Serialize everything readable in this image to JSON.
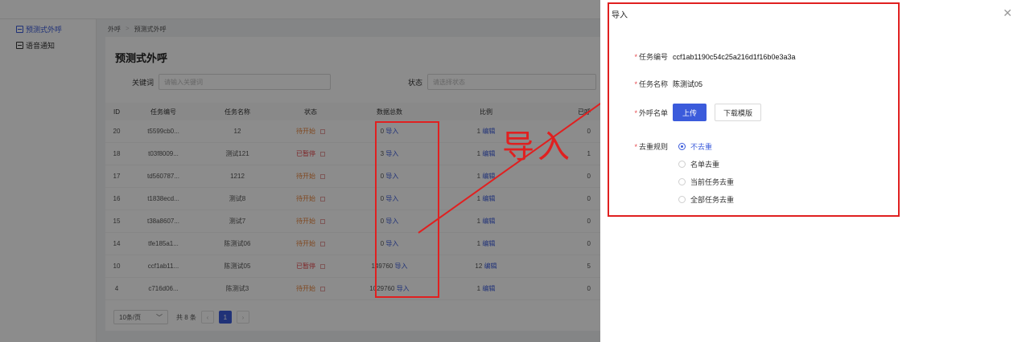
{
  "sidebar": {
    "items": [
      {
        "label": "预测式外呼",
        "active": true
      },
      {
        "label": "语音通知",
        "active": false
      }
    ]
  },
  "breadcrumb": {
    "root": "外呼",
    "current": "预测式外呼"
  },
  "page": {
    "title": "预测式外呼",
    "filters": {
      "keyword_label": "关键词",
      "keyword_placeholder": "请输入关键词",
      "status_label": "状态",
      "status_placeholder": "请选择状态"
    }
  },
  "table": {
    "headers": {
      "id": "ID",
      "no": "任务编号",
      "name": "任务名称",
      "status": "状态",
      "total": "数据总数",
      "ratio": "比例",
      "done": "已呼"
    },
    "rows": [
      {
        "id": "20",
        "no": "t5599cb0...",
        "name": "12",
        "status": "待开始",
        "status_type": "wait",
        "total": "0",
        "import": "导入",
        "ratio": "1",
        "edit": "编辑",
        "done": "0"
      },
      {
        "id": "18",
        "no": "t03f8009...",
        "name": "测试121",
        "status": "已暂停",
        "status_type": "pause",
        "total": "3",
        "import": "导入",
        "ratio": "1",
        "edit": "编辑",
        "done": "1"
      },
      {
        "id": "17",
        "no": "td560787...",
        "name": "1212",
        "status": "待开始",
        "status_type": "wait",
        "total": "0",
        "import": "导入",
        "ratio": "1",
        "edit": "编辑",
        "done": "0"
      },
      {
        "id": "16",
        "no": "t1838ecd...",
        "name": "测试8",
        "status": "待开始",
        "status_type": "wait",
        "total": "0",
        "import": "导入",
        "ratio": "1",
        "edit": "编辑",
        "done": "0"
      },
      {
        "id": "15",
        "no": "t38a8607...",
        "name": "测试7",
        "status": "待开始",
        "status_type": "wait",
        "total": "0",
        "import": "导入",
        "ratio": "1",
        "edit": "编辑",
        "done": "0"
      },
      {
        "id": "14",
        "no": "tfe185a1...",
        "name": "陈测试06",
        "status": "待开始",
        "status_type": "wait",
        "total": "0",
        "import": "导入",
        "ratio": "1",
        "edit": "编辑",
        "done": "0"
      },
      {
        "id": "10",
        "no": "ccf1ab11...",
        "name": "陈测试05",
        "status": "已暂停",
        "status_type": "pause",
        "total": "149760",
        "import": "导入",
        "ratio": "12",
        "edit": "编辑",
        "done": "5"
      },
      {
        "id": "4",
        "no": "c716d06...",
        "name": "陈测试3",
        "status": "待开始",
        "status_type": "wait",
        "total": "1029760",
        "import": "导入",
        "ratio": "1",
        "edit": "编辑",
        "done": "0"
      }
    ]
  },
  "pager": {
    "page_size": "10条/页",
    "total": "共 8 条",
    "current_page": "1"
  },
  "annotation": {
    "text": "导入",
    "color": "#e02020"
  },
  "drawer": {
    "title": "导入",
    "fields": {
      "task_no_label": "任务编号",
      "task_no_value": "ccf1ab1190c54c25a216d1f16b0e3a3a",
      "task_name_label": "任务名称",
      "task_name_value": "陈测试05",
      "list_label": "外呼名单",
      "upload_button": "上传",
      "download_button": "下载模版",
      "dedupe_label": "去重规则",
      "dedupe_options": [
        "不去重",
        "名单去重",
        "当前任务去重",
        "全部任务去重"
      ],
      "dedupe_selected": "不去重"
    }
  },
  "colors": {
    "accent": "#3b5bdb",
    "wait": "#e8833a",
    "pause": "#e5484d",
    "annotation": "#e02020"
  }
}
